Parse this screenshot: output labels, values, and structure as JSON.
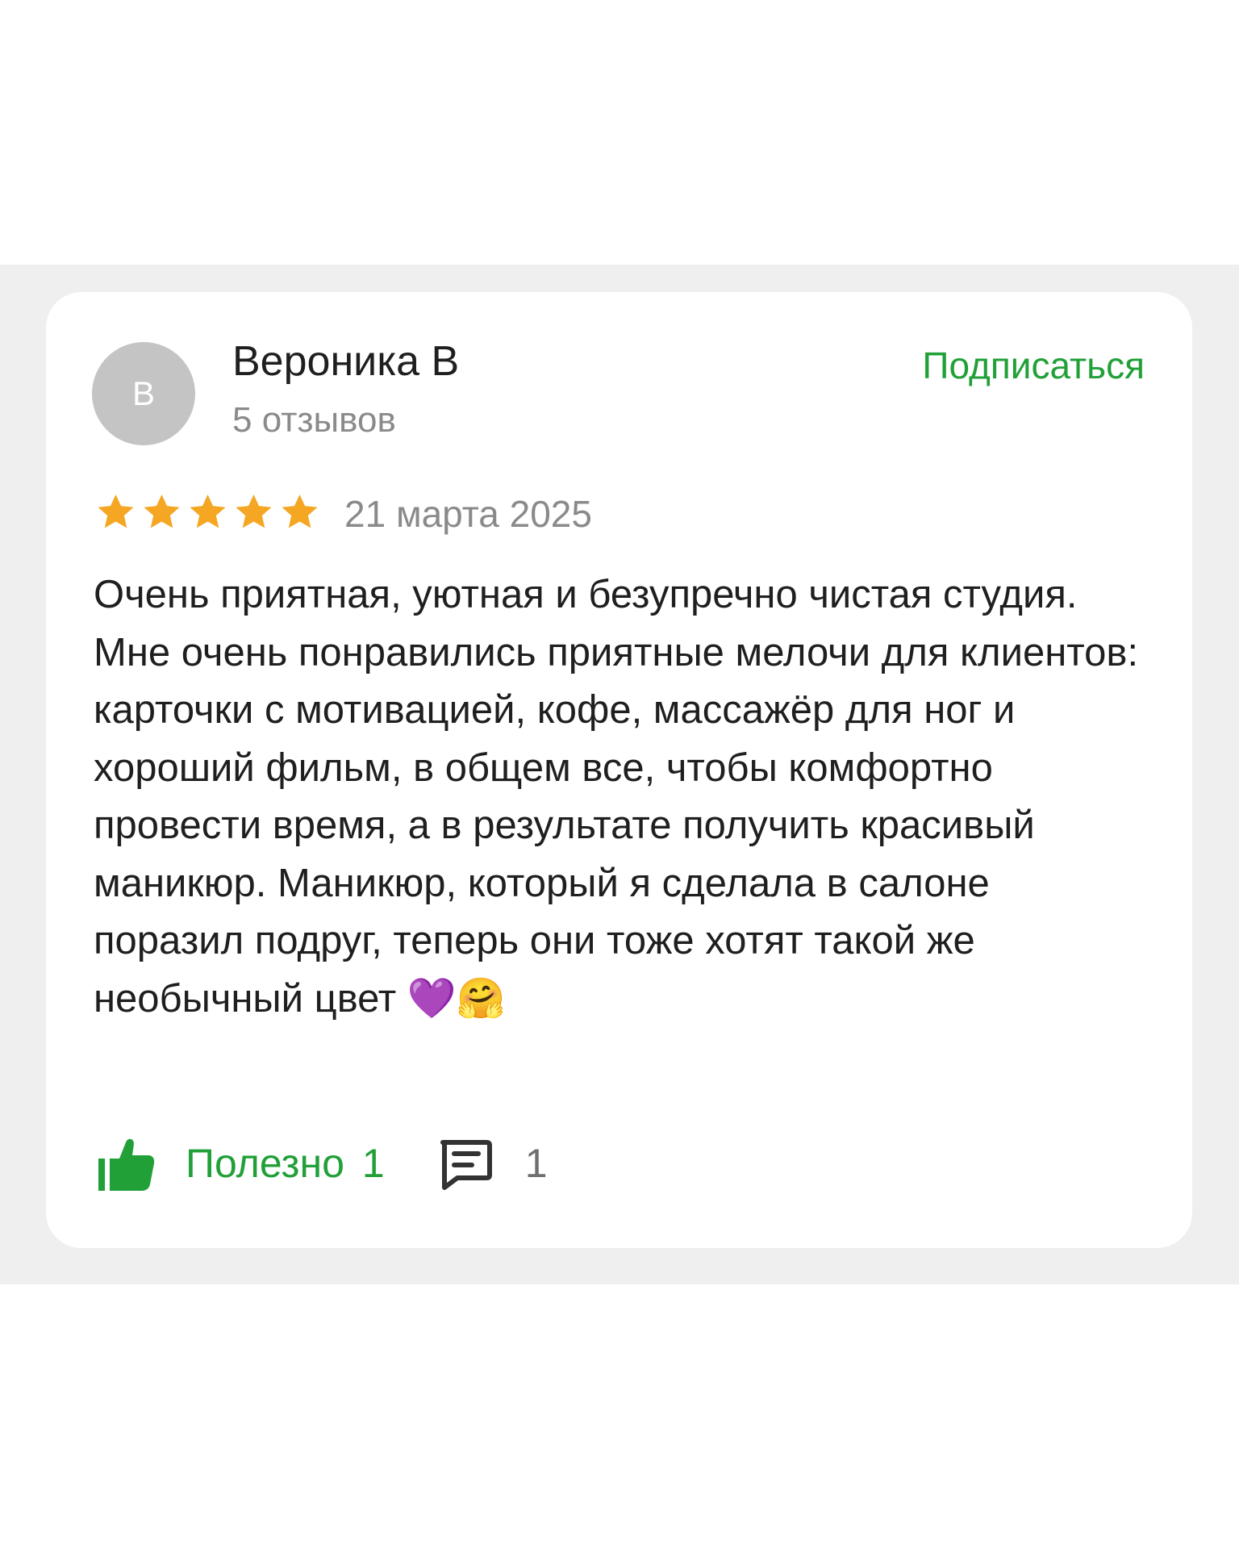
{
  "review": {
    "author": {
      "avatar_letter": "В",
      "name": "Вероника В",
      "reviews_count": "5 отзывов"
    },
    "subscribe_label": "Подписаться",
    "rating": {
      "value": 5,
      "max": 5,
      "star_color": "#f5a623"
    },
    "date": "21 марта 2025",
    "text": "Очень приятная, уютная и безупречно чистая студия. Мне очень понравились приятные мелочи для клиентов: карточки с мотивацией, кофе, массажёр для ног и хороший фильм, в общем все, чтобы комфортно провести время, а в результате получить красивый маникюр. Маникюр, который я сделала в салоне поразил подруг, теперь они тоже хотят такой же необычный цвет 💜🤗",
    "helpful": {
      "label": "Полезно",
      "count": "1",
      "icon": "thumbs-up-icon"
    },
    "comments": {
      "count": "1",
      "icon": "comment-icon"
    }
  },
  "colors": {
    "accent_green": "#21a038",
    "background_band": "#efefef",
    "card_background": "#ffffff"
  }
}
